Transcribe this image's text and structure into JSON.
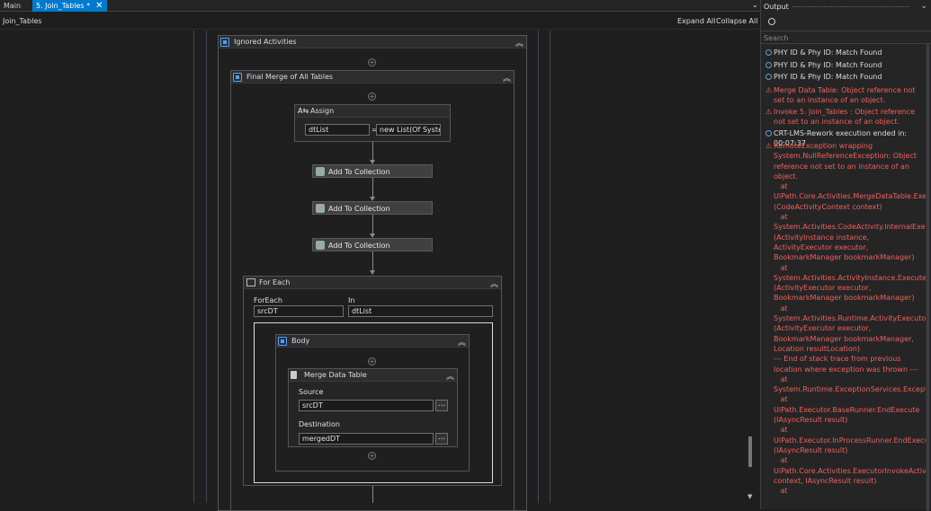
{
  "tabs": [
    {
      "label": "Main",
      "active": false
    },
    {
      "label": "5. Join_Tables *",
      "active": true
    }
  ],
  "header": {
    "breadcrumb": "Join_Tables",
    "expand_all": "Expand All",
    "collapse_all": "Collapse All"
  },
  "workflow": {
    "ignored_activities": "Ignored Activities",
    "final_merge": "Final Merge of All Tables",
    "assign": {
      "title": "Assign",
      "to": "dtList",
      "op": "=",
      "value": "new List(Of System"
    },
    "add_to_collection": [
      "Add To Collection",
      "Add To Collection",
      "Add To Collection"
    ],
    "for_each": {
      "title": "For Each",
      "item_label": "ForEach",
      "item_value": "srcDT",
      "in_label": "In",
      "in_value": "dtList"
    },
    "body": "Body",
    "merge": {
      "title": "Merge Data Table",
      "source_label": "Source",
      "source_value": "srcDT",
      "dest_label": "Destination",
      "dest_value": "mergedDT",
      "browse": "..."
    }
  },
  "output": {
    "title": "Output",
    "search_placeholder": "Search",
    "entries": [
      {
        "level": "info",
        "text": "PHY ID & Phy ID: Match Found"
      },
      {
        "level": "info",
        "text": "PHY ID & Phy ID: Match Found"
      },
      {
        "level": "info",
        "text": "PHY ID & Phy ID: Match Found"
      },
      {
        "level": "error",
        "text": "Merge Data Table: Object reference not set to an instance of an object."
      },
      {
        "level": "error",
        "text": "Invoke 5. Join_Tables : Object reference not set to an instance of an object."
      },
      {
        "level": "info",
        "text": "CRT-LMS-Rework execution ended in: 00:07:37"
      },
      {
        "level": "error",
        "text": "RemoteException wrapping System.NullReferenceException: Object reference not set to an instance of an object.\n   at UiPath.Core.Activities.MergeDataTable.Execute (CodeActivityContext context)\n   at System.Activities.CodeActivity.InternalExecute (ActivityInstance instance, ActivityExecutor executor, BookmarkManager bookmarkManager)\n   at System.Activities.ActivityInstance.Execute (ActivityExecutor executor, BookmarkManager bookmarkManager)\n   at System.Activities.Runtime.ActivityExecutor.ExecuteActivityWorkItem.ExecuteBody (ActivityExecutor executor, BookmarkManager bookmarkManager, Location resultLocation)\n--- End of stack trace from previous location where exception was thrown ---\n   at System.Runtime.ExceptionServices.ExceptionDispatchInfo.Throw()\n   at UiPath.Executor.BaseRunner.EndExecute (IAsyncResult result)\n   at UiPath.Executor.InProcessRunner.EndExecute (IAsyncResult result)\n   at UiPath.Core.Activities.ExecutorInvokeActivity.EndExecute(AsyncCodeActivityContext context, IAsyncResult result)\n   at"
      }
    ]
  }
}
